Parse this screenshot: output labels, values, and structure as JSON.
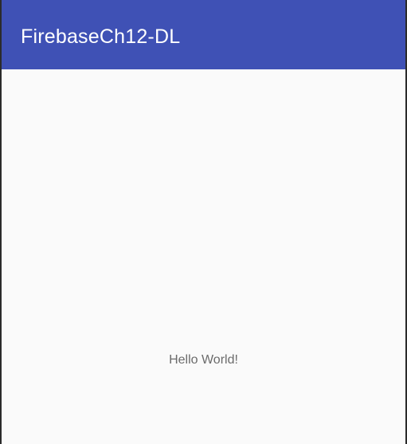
{
  "app_bar": {
    "title": "FirebaseCh12-DL"
  },
  "main": {
    "text": "Hello World!"
  },
  "colors": {
    "app_bar": "#3f51b5",
    "background": "#fafafa",
    "title_text": "#ffffff",
    "body_text": "#6b6b6b"
  }
}
